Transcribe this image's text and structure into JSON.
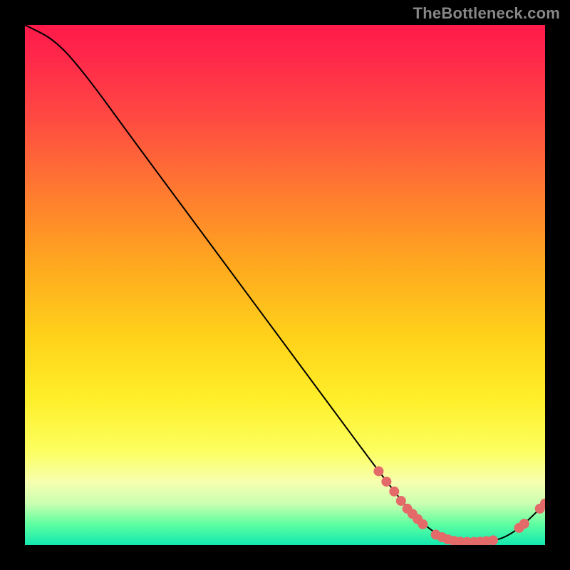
{
  "watermark": "TheBottleneck.com",
  "chart_data": {
    "type": "line",
    "title": "",
    "xlabel": "",
    "ylabel": "",
    "xlim": [
      0,
      100
    ],
    "ylim": [
      0,
      100
    ],
    "curve": [
      {
        "x": 0,
        "y": 100
      },
      {
        "x": 6,
        "y": 97
      },
      {
        "x": 12,
        "y": 90
      },
      {
        "x": 20,
        "y": 79
      },
      {
        "x": 30,
        "y": 65.5
      },
      {
        "x": 40,
        "y": 52
      },
      {
        "x": 50,
        "y": 38.5
      },
      {
        "x": 60,
        "y": 25
      },
      {
        "x": 68,
        "y": 14.2
      },
      {
        "x": 74,
        "y": 6.5
      },
      {
        "x": 79,
        "y": 2
      },
      {
        "x": 83,
        "y": 0.6
      },
      {
        "x": 88,
        "y": 0.6
      },
      {
        "x": 92,
        "y": 1.2
      },
      {
        "x": 96,
        "y": 4
      },
      {
        "x": 100,
        "y": 8
      }
    ],
    "markers_left": [
      {
        "x": 68,
        "y": 14.2
      },
      {
        "x": 69.5,
        "y": 12.2
      },
      {
        "x": 71,
        "y": 10.3
      },
      {
        "x": 72.3,
        "y": 8.5
      },
      {
        "x": 73.5,
        "y": 7.0
      },
      {
        "x": 74.5,
        "y": 6.0
      },
      {
        "x": 75.5,
        "y": 5.0
      },
      {
        "x": 76.5,
        "y": 4.0
      }
    ],
    "markers_bottom": [
      {
        "x": 79,
        "y": 2.0
      },
      {
        "x": 80.2,
        "y": 1.5
      },
      {
        "x": 81.3,
        "y": 1.1
      },
      {
        "x": 82.5,
        "y": 0.8
      },
      {
        "x": 83.7,
        "y": 0.65
      },
      {
        "x": 85.0,
        "y": 0.6
      },
      {
        "x": 86.3,
        "y": 0.6
      },
      {
        "x": 87.5,
        "y": 0.65
      },
      {
        "x": 88.7,
        "y": 0.75
      },
      {
        "x": 90.0,
        "y": 0.9
      }
    ],
    "markers_right": [
      {
        "x": 95.0,
        "y": 3.3
      },
      {
        "x": 96.0,
        "y": 4.1
      },
      {
        "x": 99.0,
        "y": 7.0
      },
      {
        "x": 100.0,
        "y": 8.0
      }
    ],
    "marker_color": "#e46a6a",
    "marker_radius": 7,
    "line_color": "#000000",
    "line_width": 2
  }
}
